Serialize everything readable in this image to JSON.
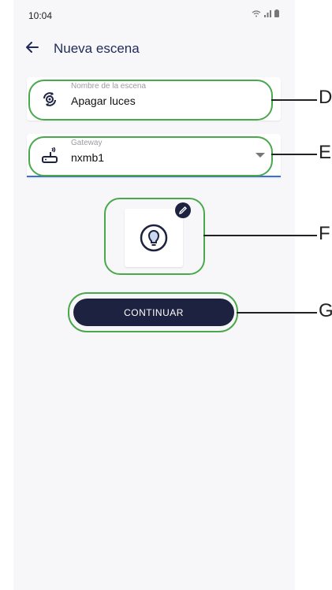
{
  "status_bar": {
    "time": "10:04",
    "wifi_icon": "wifi-icon",
    "signal_icon": "signal-icon",
    "battery_icon": "battery-icon"
  },
  "header": {
    "title": "Nueva escena",
    "back_icon": "arrow-left-icon"
  },
  "scene_name": {
    "label": "Nombre de la escena",
    "value": "Apagar luces",
    "icon": "scene-sync-icon"
  },
  "gateway": {
    "label": "Gateway",
    "value": "nxmb1",
    "icon": "router-icon"
  },
  "scene_icon": {
    "icon": "lightbulb-icon",
    "edit_icon": "pencil-icon"
  },
  "continue_label": "CONTINUAR",
  "annotations": {
    "d": "D",
    "e": "E",
    "f": "F",
    "g": "G"
  },
  "colors": {
    "primary": "#1d2240",
    "accent": "#3b6fd8",
    "highlight": "#49a84b",
    "background": "#f7f7f9"
  }
}
